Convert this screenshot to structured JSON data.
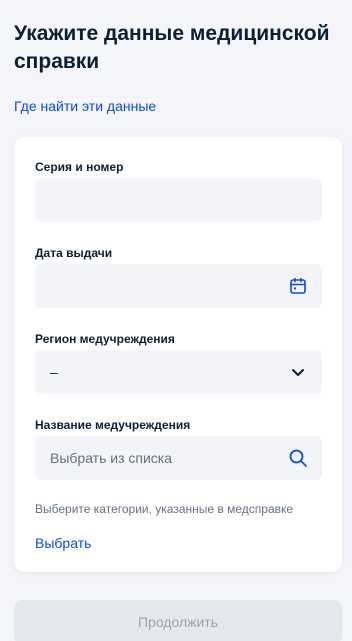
{
  "header": {
    "title": "Укажите данные медицинской справки",
    "help_link": "Где найти эти данные"
  },
  "form": {
    "series_number": {
      "label": "Серия и номер",
      "value": ""
    },
    "issue_date": {
      "label": "Дата выдачи",
      "value": "",
      "icon": "calendar-icon"
    },
    "region": {
      "label": "Регион медучреждения",
      "value": "–",
      "icon": "chevron-down-icon"
    },
    "institution": {
      "label": "Название медучреждения",
      "placeholder": "Выбрать из списка",
      "icon": "search-icon"
    },
    "categories_hint": "Выберите категории, указанные в медсправке",
    "choose_link": "Выбрать"
  },
  "footer": {
    "continue_label": "Продолжить"
  },
  "colors": {
    "accent": "#0d4cd3",
    "text": "#0b1f33",
    "muted": "#66727f",
    "field_bg": "#f2f4f7",
    "disabled_bg": "#e4e8ee"
  }
}
